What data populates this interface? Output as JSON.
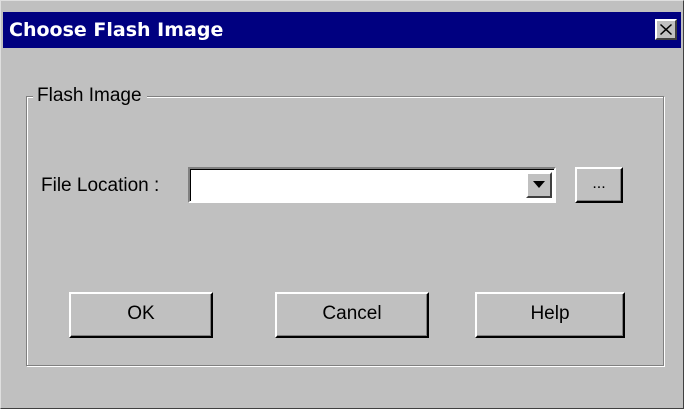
{
  "window": {
    "title": "Choose Flash Image"
  },
  "group": {
    "legend": "Flash Image"
  },
  "file_location": {
    "label": "File Location :",
    "value": "",
    "browse_label": "..."
  },
  "buttons": {
    "ok": "OK",
    "cancel": "Cancel",
    "help": "Help"
  },
  "icons": {
    "close": "close-icon",
    "dropdown": "chevron-down-icon"
  },
  "colors": {
    "titlebar": "#000080",
    "face": "#c0c0c0"
  }
}
